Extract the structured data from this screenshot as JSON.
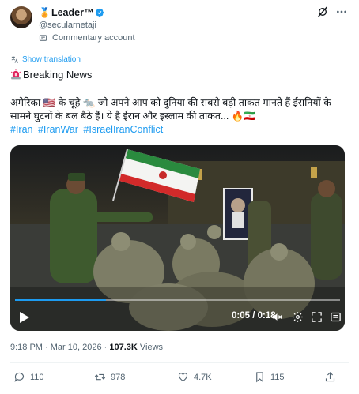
{
  "tweet": {
    "author": {
      "display_name": "Leader™",
      "prefix_emoji": "🏅",
      "handle": "@secularnetaji",
      "account_label": "Commentary account"
    },
    "show_translation": "Show translation",
    "breaking_label": "Breaking News",
    "body": "अमेरिका 🇺🇸 के चूहे 🐀 जो अपने आप को दुनिया की सबसे बड़ी ताकत मानते हैं ईरानियों के सामने घुटनों के बल बैठे हैं। ये है ईरान और इस्लाम की ताकत... 🔥🇮🇷",
    "hashtags": [
      "#Iran",
      "#IranWar",
      "#IsraelIranConflict"
    ],
    "video": {
      "time": "0:05 / 0:18",
      "progress": 0.28
    },
    "timestamp": "9:18 PM · Mar 10, 2026 · ",
    "views_count": "107.3K",
    "views_label": " Views",
    "actions": {
      "replies": "110",
      "reposts": "978",
      "likes": "4.7K",
      "bookmarks": "115"
    },
    "colors": {
      "link": "#1d9bf0",
      "secondary_text": "#536471",
      "primary_text": "#0f1419"
    }
  }
}
